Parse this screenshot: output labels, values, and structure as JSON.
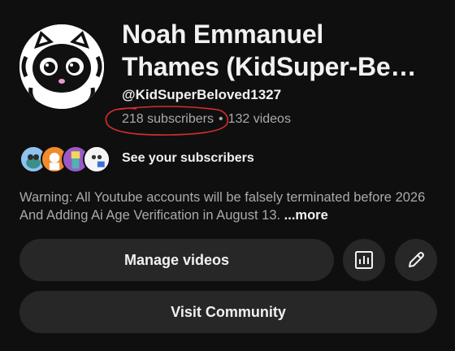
{
  "channel": {
    "name_line1": "Noah Emmanuel",
    "name_line2": "Thames (KidSuper-Be…",
    "handle": "@KidSuperBeloved1327",
    "subscribers": "218 subscribers",
    "separator": "•",
    "videos": "132 videos",
    "avatar_icon": "raccoon-avatar-icon"
  },
  "subscribers_row": {
    "label": "See your subscribers"
  },
  "description": {
    "text": "Warning: All Youtube accounts will be falsely terminated before 2026 And Adding Ai Age Verification in August 13. ",
    "more_label": "...more"
  },
  "actions": {
    "manage_label": "Manage videos",
    "analytics_icon": "analytics-icon",
    "edit_icon": "pencil-icon",
    "community_label": "Visit Community"
  },
  "colors": {
    "background": "#0f0f0f",
    "button": "#272727",
    "primary_text": "#f1f1f1",
    "secondary_text": "#aaaaaa",
    "highlight_circle": "#d32f2f"
  }
}
